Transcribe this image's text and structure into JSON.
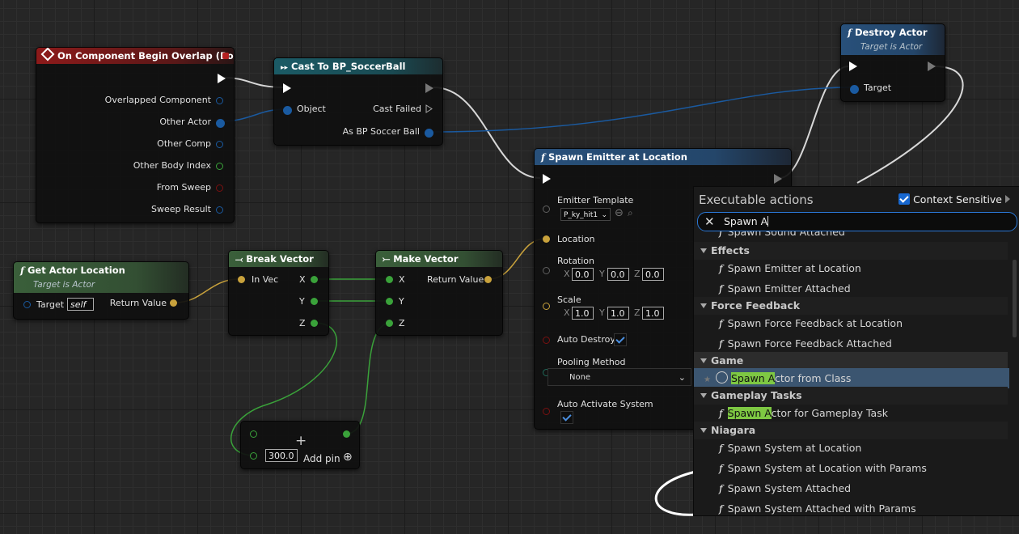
{
  "nodes": {
    "overlap": {
      "title": "On Component Begin Overlap (Box)",
      "pins": [
        "Overlapped Component",
        "Other Actor",
        "Other Comp",
        "Other Body Index",
        "From Sweep",
        "Sweep Result"
      ]
    },
    "cast": {
      "title": "Cast To BP_SoccerBall",
      "object_label": "Object",
      "cast_failed_label": "Cast Failed",
      "as_label": "As BP Soccer Ball"
    },
    "destroy": {
      "title": "Destroy Actor",
      "subtitle": "Target is Actor",
      "target_label": "Target"
    },
    "spawn_emitter": {
      "title": "Spawn Emitter at Location",
      "emitter_template_label": "Emitter Template",
      "emitter_template_value": "P_ky_hit1",
      "location_label": "Location",
      "rotation_label": "Rotation",
      "rotation": [
        "0.0",
        "0.0",
        "0.0"
      ],
      "scale_label": "Scale",
      "scale": [
        "1.0",
        "1.0",
        "1.0"
      ],
      "auto_destroy_label": "Auto Destroy",
      "pooling_label": "Pooling Method",
      "pooling_value": "None",
      "auto_activate_label": "Auto Activate System",
      "axes": [
        "X",
        "Y",
        "Z"
      ]
    },
    "get_location": {
      "title": "Get Actor Location",
      "subtitle": "Target is Actor",
      "target_label": "Target",
      "target_value": "self",
      "return_label": "Return Value"
    },
    "break_vector": {
      "title": "Break Vector",
      "in_label": "In Vec",
      "outs": [
        "X",
        "Y",
        "Z"
      ]
    },
    "make_vector": {
      "title": "Make Vector",
      "ins": [
        "X",
        "Y",
        "Z"
      ],
      "return_label": "Return Value"
    },
    "add": {
      "value": "300.0",
      "add_pin_label": "Add pin"
    }
  },
  "menu": {
    "title": "Executable actions",
    "context_label": "Context Sensitive",
    "search_value": "Spawn A",
    "top_partial": "Spawn Sound Attached",
    "categories": [
      {
        "name": "Effects",
        "items": [
          "Spawn Emitter at Location",
          "Spawn Emitter Attached"
        ]
      },
      {
        "name": "Force Feedback",
        "items": [
          "Spawn Force Feedback at Location",
          "Spawn Force Feedback Attached"
        ]
      },
      {
        "name": "Game",
        "selected_match": "Spawn A",
        "selected_rest": "ctor from Class"
      },
      {
        "name": "Gameplay Tasks",
        "match": "Spawn A",
        "rest": "ctor for Gameplay Task"
      },
      {
        "name": "Niagara",
        "items": [
          "Spawn System at Location",
          "Spawn System at Location with Params",
          "Spawn System Attached",
          "Spawn System Attached with Params"
        ]
      }
    ]
  },
  "colors": {
    "exec": "#ffffff",
    "object_pin": "#1a5aa0",
    "float_pin": "#3aa23a",
    "vector_pin": "#c9a23c",
    "highlight": "#7ec843",
    "selection": "#3b5570"
  }
}
